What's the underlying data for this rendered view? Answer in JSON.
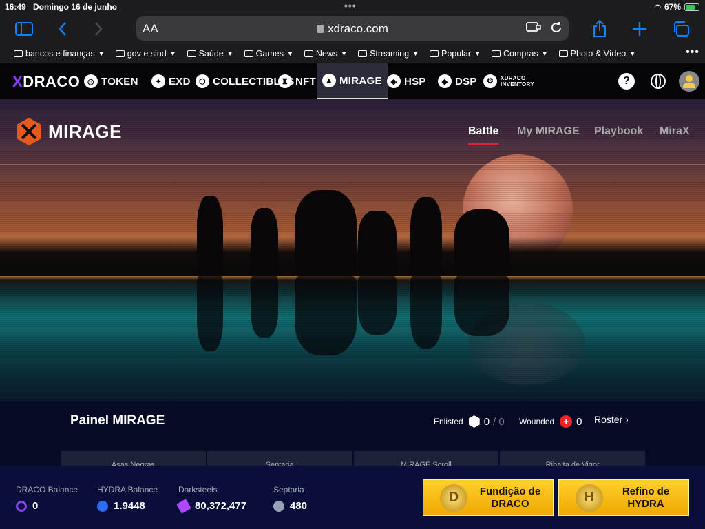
{
  "status_bar": {
    "time": "16:49",
    "date": "Domingo 16 de junho",
    "battery": "67%"
  },
  "browser": {
    "text_size_label": "AA",
    "url": "xdraco.com"
  },
  "bookmarks": [
    {
      "label": "bancos e finanças"
    },
    {
      "label": "gov e sind"
    },
    {
      "label": "Saúde"
    },
    {
      "label": "Games"
    },
    {
      "label": "News"
    },
    {
      "label": "Streaming"
    },
    {
      "label": "Popular"
    },
    {
      "label": "Compras"
    },
    {
      "label": "Photo & Vídeo"
    }
  ],
  "site_nav": {
    "logo_x": "X",
    "logo_rest": "DRACO",
    "items": [
      {
        "label": "TOKEN"
      },
      {
        "label": "EXD"
      },
      {
        "label": "COLLECTIBLES"
      },
      {
        "label": "NFT"
      },
      {
        "label": "MIRAGE"
      },
      {
        "label": "HSP"
      },
      {
        "label": "DSP"
      },
      {
        "label": "XDRACO INVENTORY"
      }
    ],
    "help": "?"
  },
  "hero": {
    "title": "MIRAGE",
    "tabs": [
      {
        "label": "Battle"
      },
      {
        "label": "My MIRAGE"
      },
      {
        "label": "Playbook"
      },
      {
        "label": "MiraX"
      }
    ]
  },
  "panel": {
    "title": "Painel MIRAGE",
    "enlisted_label": "Enlisted",
    "enlisted_value": "0",
    "enlisted_total": "/ 0",
    "wounded_label": "Wounded",
    "wounded_value": "0",
    "roster_label": "Roster",
    "cards": [
      "Asas Negras",
      "Septaria",
      "MIRAGE Scroll",
      "Ribalta de Vigor"
    ]
  },
  "balances": [
    {
      "label": "DRACO Balance",
      "value": "0",
      "color": "#8a3ffc"
    },
    {
      "label": "HYDRA Balance",
      "value": "1.9448",
      "color": "#2b6cf6"
    },
    {
      "label": "Darksteels",
      "value": "80,372,477",
      "color": "#b048ff"
    },
    {
      "label": "Septaria",
      "value": "480",
      "color": "#9aa0b8"
    }
  ],
  "actions": [
    {
      "label_line1": "Fundição de",
      "label_line2": "DRACO",
      "icon": "D"
    },
    {
      "label_line1": "Refino de",
      "label_line2": "HYDRA",
      "icon": "H"
    }
  ]
}
